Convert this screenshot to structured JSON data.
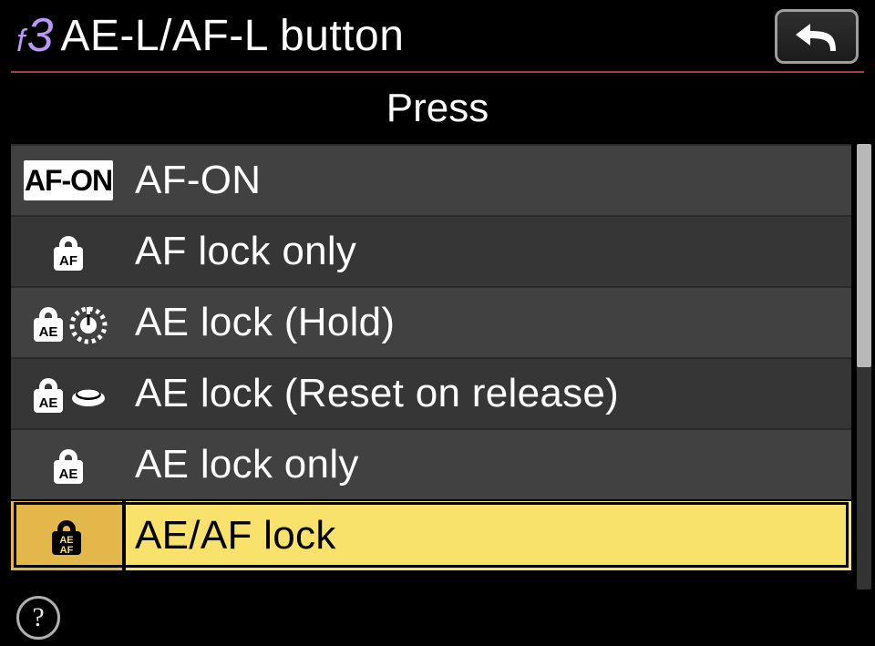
{
  "header": {
    "menu_letter": "f",
    "menu_number": "3",
    "title": "AE-L/AF-L button"
  },
  "subheader": "Press",
  "options": [
    {
      "label": "AF-ON",
      "icon": "afon",
      "selected": false
    },
    {
      "label": "AF lock only",
      "icon": "lock-af",
      "selected": false
    },
    {
      "label": "AE lock (Hold)",
      "icon": "lock-ae-hold",
      "selected": false
    },
    {
      "label": "AE lock (Reset on release)",
      "icon": "lock-ae-reset",
      "selected": false
    },
    {
      "label": "AE lock only",
      "icon": "lock-ae",
      "selected": false
    },
    {
      "label": "AE/AF lock",
      "icon": "lock-aeaf",
      "selected": true
    }
  ],
  "footer": {
    "help_label": "?"
  }
}
